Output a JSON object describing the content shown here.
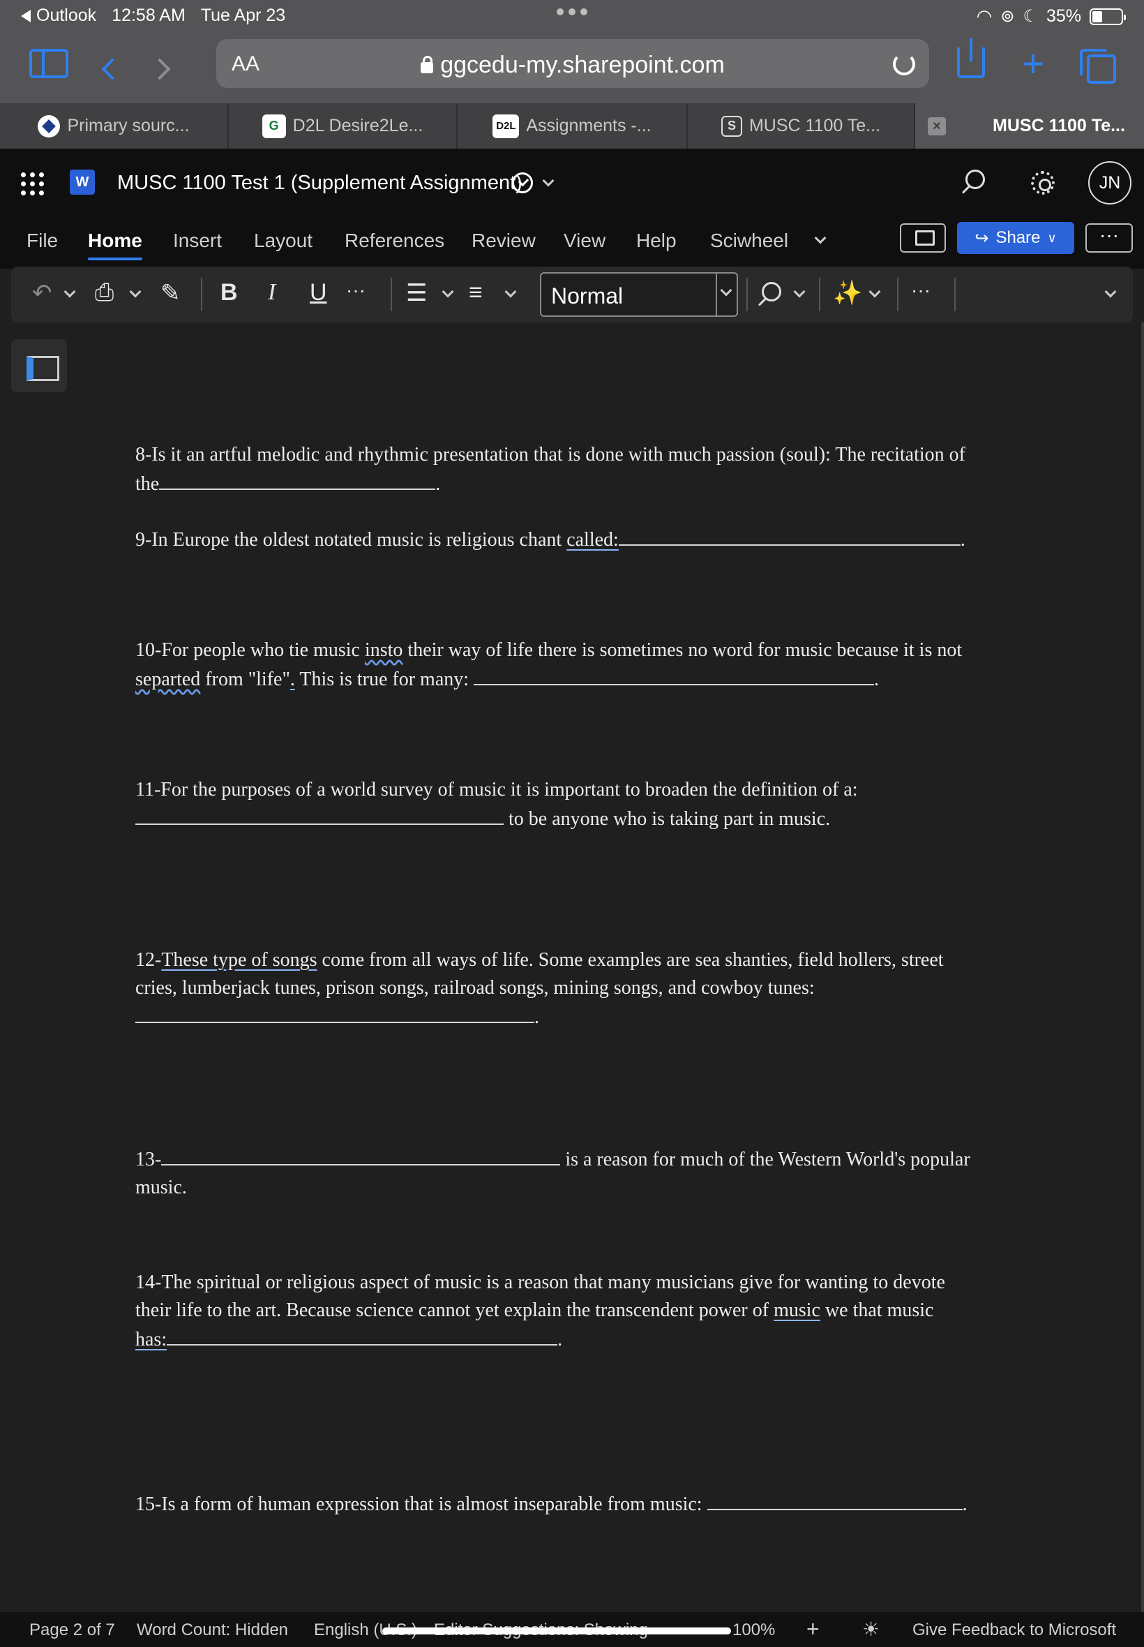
{
  "status": {
    "back_app": "Outlook",
    "time": "12:58 AM",
    "date": "Tue Apr 23",
    "battery": "35%",
    "battery_level": 0.35
  },
  "browser": {
    "text_size_label": "AA",
    "url": "ggcedu-my.sharepoint.com",
    "tabs": [
      {
        "label": "Primary sourc...",
        "icon": "circle-logo-icon",
        "favicon": ""
      },
      {
        "label": "D2L Desire2Le...",
        "icon": "g-logo-icon",
        "favicon": "G"
      },
      {
        "label": "Assignments -...",
        "icon": "d2l-logo-icon",
        "favicon": "D2L"
      },
      {
        "label": "MUSC 1100 Te...",
        "icon": "s-logo-icon",
        "favicon": "S"
      },
      {
        "label": "MUSC 1100 Te...",
        "icon": "close-icon",
        "favicon": "×"
      }
    ]
  },
  "word": {
    "app_icon": "W",
    "doc_title": "MUSC 1100 Test 1 (Supplement Assignment)",
    "avatar": "JN",
    "ribbon_tabs": [
      "File",
      "Home",
      "Insert",
      "Layout",
      "References",
      "Review",
      "View",
      "Help",
      "Sciwheel"
    ],
    "active_tab": "Home",
    "share_label": "Share",
    "more_label": "···",
    "style_value": "Normal",
    "bold": "B",
    "italic": "I",
    "underline": "U",
    "ellipsis": "···"
  },
  "document": {
    "q8": {
      "line1": "8-Is it an artful melodic and rhythmic presentation that is done with much passion (soul): The recitation of",
      "line2_pre": "the",
      "line2_post": "."
    },
    "q9": {
      "pre": "9-In Europe the oldest notated music is religious chant ",
      "ul": "called:",
      "post": "."
    },
    "q10": {
      "line1_pre": "10-For people who tie music ",
      "line1_sq": "insto",
      "line1_post": " their way of life there is sometimes no word for music because it is not",
      "line2_sq": "separted",
      "line2_mid": " from \"life\"",
      "line2_ul": ".",
      "line2_post": " This is true for many: ",
      "line2_end": "."
    },
    "q11": {
      "line1": "11-For the purposes of a world survey of music it is important to broaden the definition of a:",
      "line2_post": " to be anyone who is taking part in music."
    },
    "q12": {
      "line1_pre": "12-",
      "line1_ul": "These type of songs",
      "line1_post": " come from all ways of life. Some examples are sea shanties, field hollers, street",
      "line2": "cries, lumberjack tunes, prison songs, railroad songs, mining songs, and cowboy tunes:",
      "line3_post": "."
    },
    "q13": {
      "line1_pre": "13-",
      "line1_post": " is a reason for much of the Western World's popular",
      "line2": "music."
    },
    "q14": {
      "line1": "14-The spiritual or religious aspect of music is a reason that many musicians give for wanting to devote",
      "line2_pre": "their life to the art. Because science cannot yet explain the transcendent power of ",
      "line2_ul": "music",
      "line2_post": " we that music",
      "line3_ul": "has:",
      "line3_post": "."
    },
    "q15": {
      "pre": "15-Is a form of human expression that is almost inseparable from music: ",
      "post": "."
    }
  },
  "footer": {
    "page": "Page 2 of 7",
    "word_count": "Word Count: Hidden",
    "language": "English (U.S.)",
    "editor": "Editor Suggestions: Showing",
    "zoom": "100%",
    "zoom_in": "+",
    "feedback": "Give Feedback to Microsoft"
  }
}
